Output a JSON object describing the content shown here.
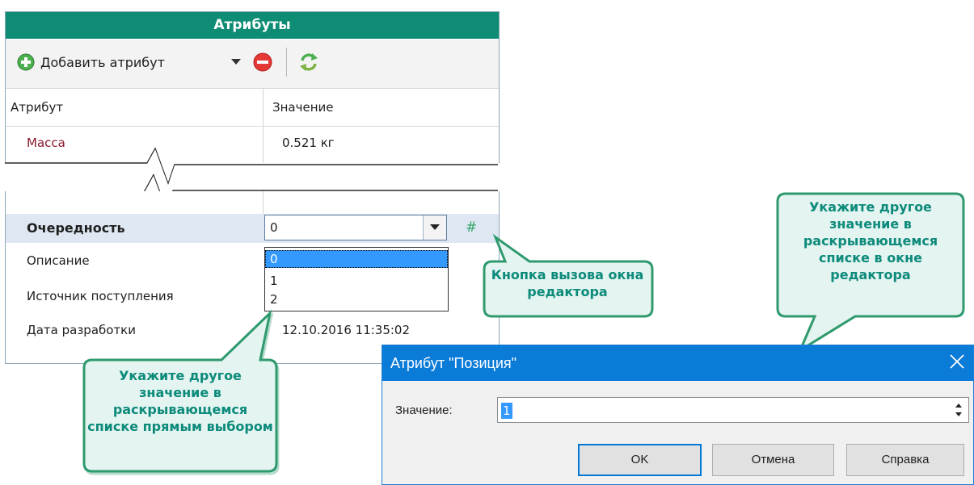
{
  "panel": {
    "title": "Атрибуты",
    "toolbar": {
      "add_label": "Добавить атрибут"
    },
    "columns": {
      "attribute": "Атрибут",
      "value": "Значение"
    },
    "rows": [
      {
        "name": "Масса",
        "value": "0.521 кг"
      },
      {
        "name": "Очередность",
        "value": "0"
      },
      {
        "name": "Описание",
        "value": ""
      },
      {
        "name": "Источник поступления",
        "value": ""
      },
      {
        "name": "Дата разработки",
        "value": "12.10.2016 11:35:02"
      }
    ],
    "combo_options": [
      "0",
      "1",
      "2"
    ],
    "hash_symbol": "#"
  },
  "dialog": {
    "title": "Атрибут \"Позиция\"",
    "field_label": "Значение:",
    "field_value": "1",
    "ok": "OK",
    "cancel": "Отмена",
    "help": "Справка"
  },
  "callouts": {
    "editor_button": "Кнопка вызова окна редактора",
    "editor_dropdown": "Укажите другое значение в раскрывающемся списке в окне редактора",
    "direct_select": "Укажите другое значение в раскрывающемся списке прямым выбором"
  },
  "colors": {
    "header_bg": "#0f8c74",
    "callout_bg": "#dff2f0",
    "callout_border": "#2f9a6e",
    "callout_text": "#0c8a7a",
    "dialog_title": "#0b7bd8",
    "selection": "#3399ff"
  }
}
